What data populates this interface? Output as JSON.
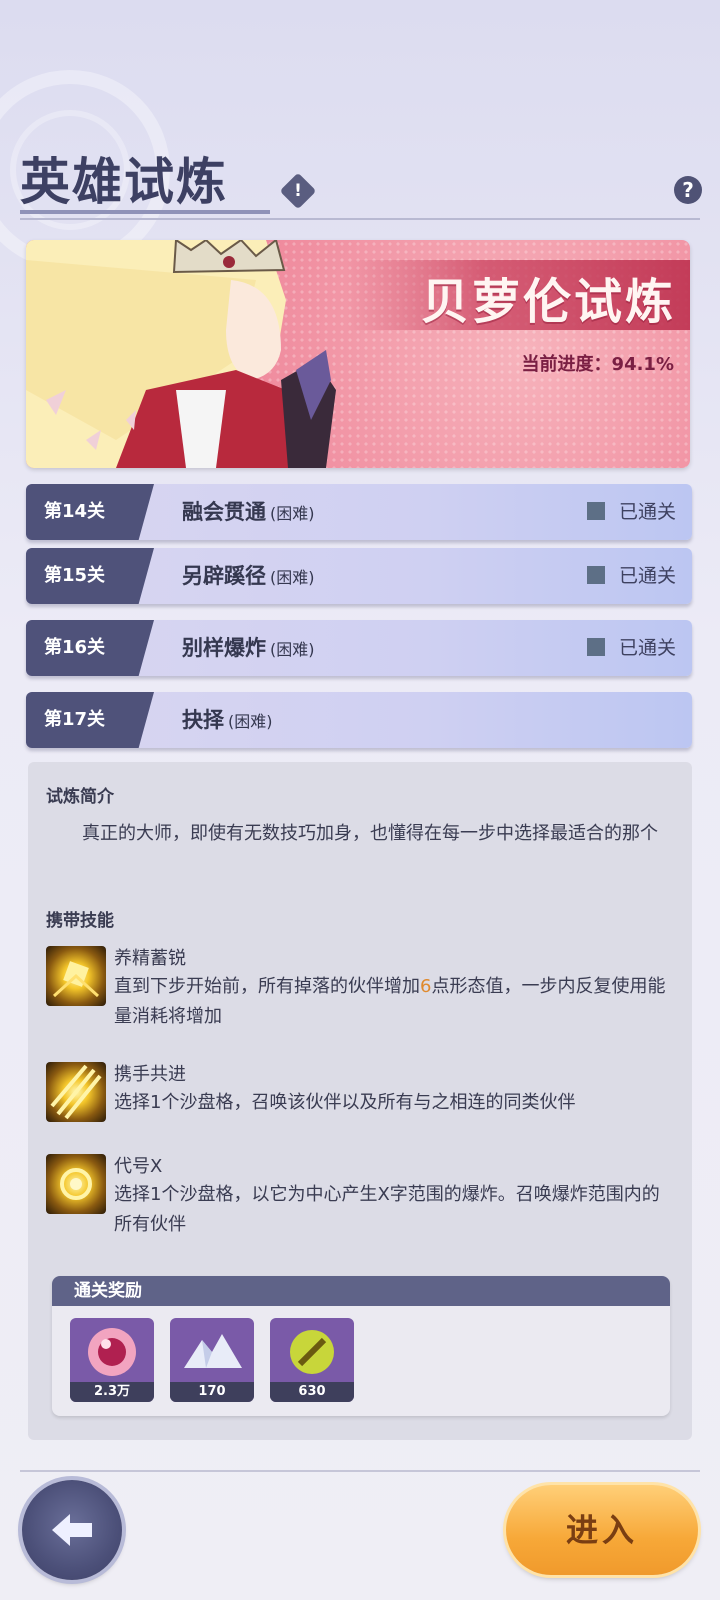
{
  "header": {
    "title": "英雄试炼"
  },
  "banner": {
    "title": "贝萝伦试炼",
    "progress_label": "当前进度：",
    "progress_value": "94.1%"
  },
  "stages": [
    {
      "num": "第14关",
      "name": "融会贯通",
      "difficulty": "(困难)",
      "status": "已通关"
    },
    {
      "num": "第15关",
      "name": "另辟蹊径",
      "difficulty": "(困难)",
      "status": "已通关"
    },
    {
      "num": "第16关",
      "name": "别样爆炸",
      "difficulty": "(困难)",
      "status": "已通关"
    },
    {
      "num": "第17关",
      "name": "抉择",
      "difficulty": "(困难)",
      "status": ""
    }
  ],
  "intro": {
    "title": "试炼简介",
    "text": "　　真正的大师，即使有无数技巧加身，也懂得在每一步中选择最适合的那个"
  },
  "skills": {
    "title": "携带技能",
    "items": [
      {
        "name": "养精蓄锐",
        "desc_before": "直到下步开始前，所有掉落的伙伴增加",
        "desc_highlight": "6",
        "desc_after": "点形态值，一步内反复使用能量消耗将增加"
      },
      {
        "name": "携手共进",
        "desc_before": "选择1个沙盘格，召唤该伙伴以及所有与之相连的同类伙伴",
        "desc_highlight": "",
        "desc_after": ""
      },
      {
        "name": "代号X",
        "desc_before": "选择1个沙盘格，以它为中心产生X字范围的爆炸。召唤爆炸范围内的所有伙伴",
        "desc_highlight": "",
        "desc_after": ""
      }
    ]
  },
  "rewards": {
    "title": "通关奖励",
    "items": [
      {
        "icon": "pink-orb-icon",
        "count": "2.3万"
      },
      {
        "icon": "crystal-pile-icon",
        "count": "170"
      },
      {
        "icon": "gold-sword-orb-icon",
        "count": "630"
      }
    ]
  },
  "buttons": {
    "enter": "进入"
  },
  "colors": {
    "accent": "#4f527a",
    "enter": "#f7a838",
    "banner": "#f08d9f",
    "highlight": "#e08a2e"
  }
}
